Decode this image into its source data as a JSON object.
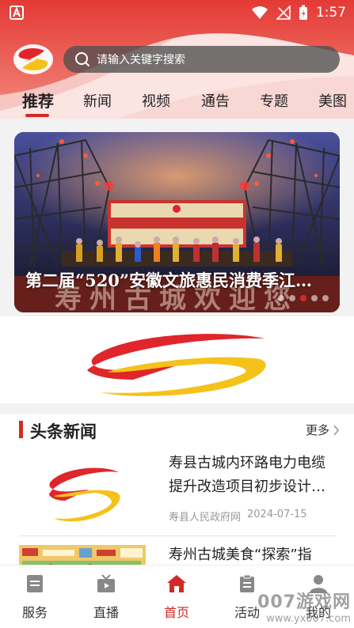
{
  "status_bar": {
    "time": "1:57"
  },
  "search": {
    "placeholder": "请输入关键字搜索"
  },
  "tabs": [
    {
      "label": "推荐",
      "active": true
    },
    {
      "label": "新闻"
    },
    {
      "label": "视频"
    },
    {
      "label": "通告"
    },
    {
      "label": "专题"
    },
    {
      "label": "美图"
    }
  ],
  "banner": {
    "title": "第二届“520”安徽文旅惠民消费季江…",
    "image_text": "寿州古城欢迎您",
    "slide_count": 5,
    "active_slide": 2
  },
  "headlines": {
    "section_title": "头条新闻",
    "more_label": "更多",
    "items": [
      {
        "title": "寿县古城内环路电力电缆提升改造项目初步设计…",
        "source": "寿县人民政府网",
        "date": "2024-07-15"
      },
      {
        "title": "寿州古城美食“探索”指"
      }
    ]
  },
  "bottom_nav": [
    {
      "label": "服务",
      "icon": "service-icon"
    },
    {
      "label": "直播",
      "icon": "tv-icon"
    },
    {
      "label": "首页",
      "icon": "home-icon",
      "active": true
    },
    {
      "label": "活动",
      "icon": "clipboard-icon"
    },
    {
      "label": "我的",
      "icon": "user-icon"
    }
  ],
  "watermark": {
    "line1": "007游戏网",
    "line2": "www.yx007.com"
  },
  "colors": {
    "accent": "#d22a26",
    "logo_red": "#e0262b",
    "logo_yellow": "#f5c21b"
  }
}
